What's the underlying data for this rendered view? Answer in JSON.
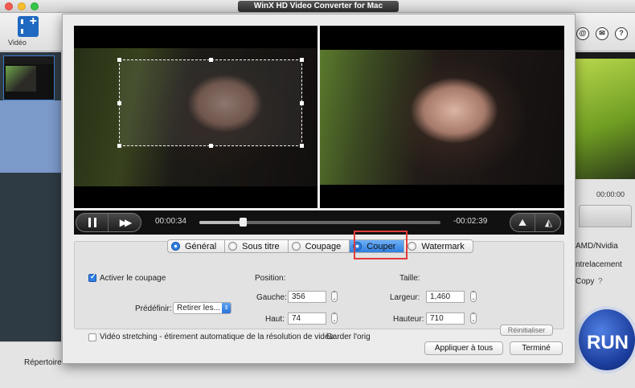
{
  "window": {
    "title": "WinX HD Video Converter for Mac"
  },
  "toolbar": {
    "video_label": "Vidéo",
    "icons": [
      "user-icon",
      "mail-icon",
      "help-icon"
    ]
  },
  "right_panel": {
    "time": "00:00:00",
    "hw_label": "AMD/Nvidia",
    "deinterlace_label": "ntrelacement",
    "copy_label": "Copy",
    "copy_help": "?",
    "run_label": "RUN"
  },
  "bottom": {
    "output_dir_label": "Répertoire"
  },
  "player": {
    "current_time": "00:00:34",
    "remaining_time": "-00:02:39",
    "progress": 0.18
  },
  "tabs": [
    {
      "label": "Général",
      "active": false
    },
    {
      "label": "Sous titre",
      "active": false
    },
    {
      "label": "Coupage",
      "active": false
    },
    {
      "label": "Couper",
      "active": true
    },
    {
      "label": "Watermark",
      "active": false
    }
  ],
  "crop": {
    "enable_label": "Activer le coupage",
    "enable_checked": true,
    "preset_label": "Prédéfinir:",
    "preset_value": "Retirer les...",
    "position_label": "Position:",
    "left_label": "Gauche:",
    "left_value": "356",
    "top_label": "Haut:",
    "top_value": "74",
    "size_label": "Taille:",
    "width_label": "Largeur:",
    "width_value": "1,460",
    "height_label": "Hauteur:",
    "height_value": "710",
    "reset_label": "Réinitialiser",
    "stretch_label": "Vidéo stretching - étirement automatique de la résolution de vidéo:",
    "stretch_checked": false,
    "keep_label": "Garder l'orig"
  },
  "footer": {
    "apply_all_label": "Appliquer à tous",
    "done_label": "Terminé"
  }
}
